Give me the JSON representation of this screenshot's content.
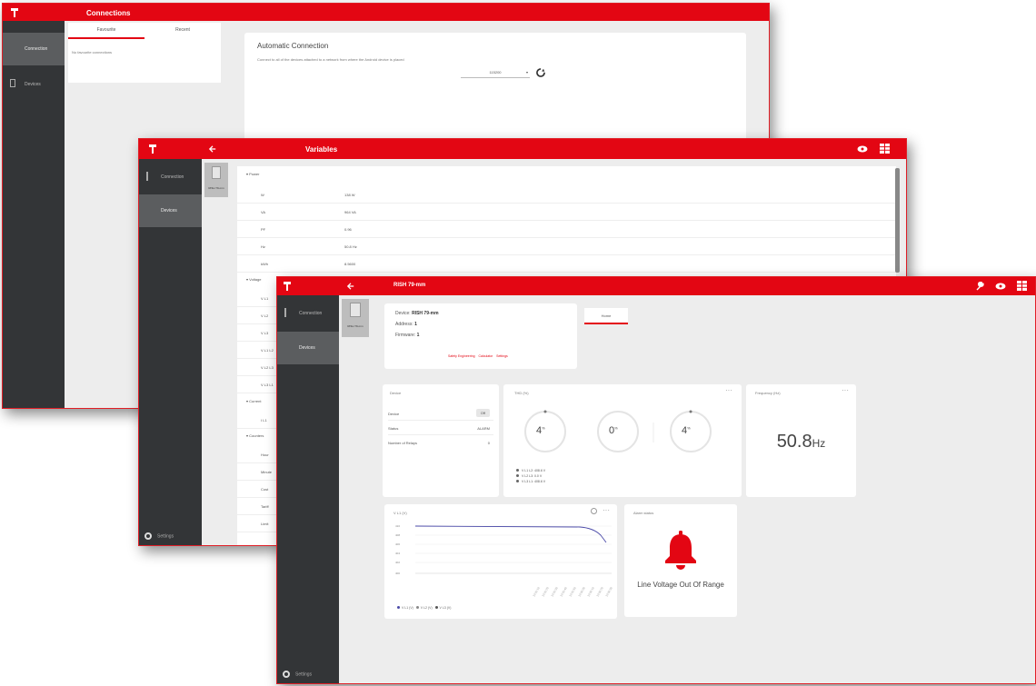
{
  "brand": {
    "accent": "#e30613",
    "sidebar": "#333537"
  },
  "win1": {
    "title": "Connections",
    "sidebar": [
      {
        "label": "Connection",
        "active": true
      },
      {
        "label": "Devices",
        "active": false
      }
    ],
    "tabs": [
      "Favourite",
      "Recent"
    ],
    "list_empty": "No favourite connections",
    "auto": {
      "heading": "Automatic Connection",
      "description": "Connect to all of the devices attached to a network from where the Android device is placed",
      "select_value": "115200"
    }
  },
  "win2": {
    "title": "Variables",
    "sidebar": [
      {
        "label": "Connection",
        "active": false
      },
      {
        "label": "Devices",
        "active": true
      }
    ],
    "device_thumb_label": "RISH 79-mm",
    "bottom_label": "Settings",
    "groups": [
      {
        "name": "Power",
        "rows": [
          {
            "name": "W",
            "value": "138 W"
          },
          {
            "name": "VA",
            "value": "964 VA"
          },
          {
            "name": "PF",
            "value": "0.96"
          },
          {
            "name": "Hz",
            "value": "50.8 Hz"
          },
          {
            "name": "kWh",
            "value": "8.5600"
          }
        ]
      },
      {
        "name": "Voltage",
        "rows": [
          {
            "name": "V L1",
            "value": ""
          },
          {
            "name": "V L2",
            "value": ""
          },
          {
            "name": "V L3",
            "value": ""
          },
          {
            "name": "V L1 L2",
            "value": ""
          },
          {
            "name": "V L2 L3",
            "value": ""
          },
          {
            "name": "V L3 L1",
            "value": ""
          }
        ]
      },
      {
        "name": "Current",
        "rows": [
          {
            "name": "I L1",
            "value": ""
          }
        ]
      },
      {
        "name": "Counters",
        "rows": [
          {
            "name": "Hour",
            "value": ""
          },
          {
            "name": "Minute",
            "value": ""
          },
          {
            "name": "Cost",
            "value": ""
          },
          {
            "name": "Tariff",
            "value": ""
          },
          {
            "name": "Limit",
            "value": ""
          }
        ]
      }
    ]
  },
  "win3": {
    "title": "RISH 79-mm",
    "sidebar": [
      {
        "label": "Connection",
        "active": false
      },
      {
        "label": "Devices",
        "active": true
      }
    ],
    "device_thumb_label": "RISH 79-mm",
    "bottom_label": "Settings",
    "info": {
      "device_label": "Device:",
      "device_value": "RISH 79-mm",
      "address_label": "Address:",
      "address_value": "1",
      "firmware_label": "Firmware:",
      "firmware_value": "1",
      "links": [
        "Safety Engineering",
        "Calculator",
        "Settings"
      ]
    },
    "tab": "Home",
    "status_card": {
      "title": "Device",
      "rows": [
        {
          "label": "Device",
          "value": "Off"
        },
        {
          "label": "Status",
          "value": "ALARM"
        },
        {
          "label": "Number of Relays",
          "value": "0"
        }
      ]
    },
    "thd_card": {
      "title": "THD (%)",
      "gauges": [
        {
          "value": "4",
          "unit": "%"
        },
        {
          "value": "0",
          "unit": "%"
        },
        {
          "value": "4",
          "unit": "%"
        }
      ],
      "legend": [
        "V L1 L2: 408.6 V",
        "V L2 L3: 0.0 V",
        "V L3 L1: 408.6 V"
      ]
    },
    "freq_card": {
      "title": "Frequency (Hz)",
      "value": "50.8",
      "unit": "Hz"
    },
    "chart_card": {
      "title": "V L1 (V)",
      "legend": [
        "V L1 (V)",
        "V L2 (V)",
        "V L3 (V)"
      ]
    },
    "alarm_card": {
      "title": "Alarm status",
      "message": "Line Voltage Out Of Range"
    }
  }
}
